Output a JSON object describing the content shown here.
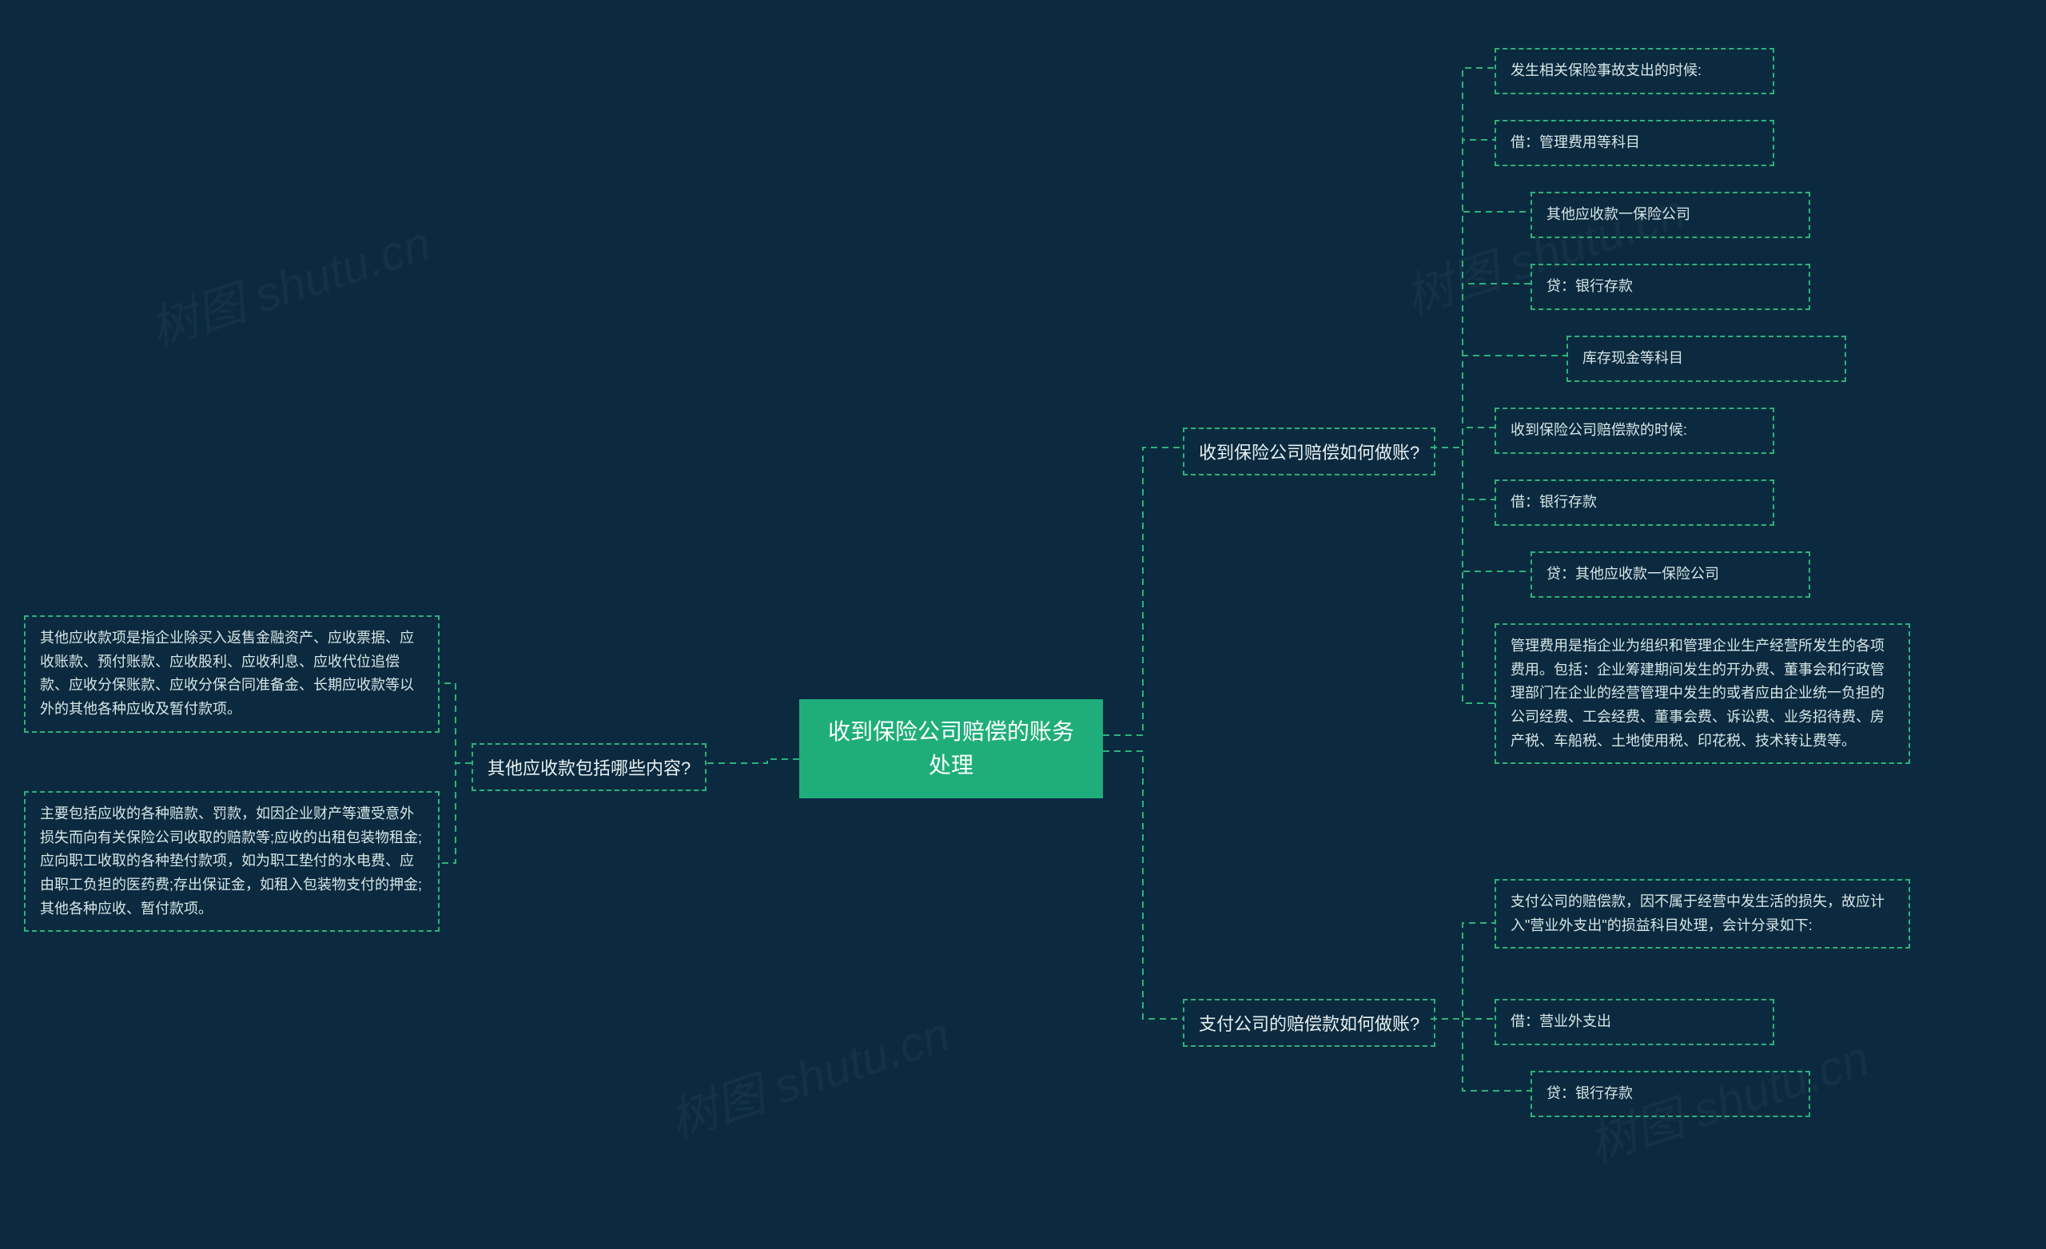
{
  "root": "收到保险公司赔偿的账务处理",
  "watermark": "树图 shutu.cn",
  "left": {
    "branch": "其他应收款包括哪些内容?",
    "leaves": [
      "其他应收款项是指企业除买入返售金融资产、应收票据、应收账款、预付账款、应收股利、应收利息、应收代位追偿款、应收分保账款、应收分保合同准备金、长期应收款等以外的其他各种应收及暂付款项。",
      "主要包括应收的各种赔款、罚款，如因企业财产等遭受意外损失而向有关保险公司收取的赔款等;应收的出租包装物租金;应向职工收取的各种垫付款项，如为职工垫付的水电费、应由职工负担的医药费;存出保证金，如租入包装物支付的押金;其他各种应收、暂付款项。"
    ]
  },
  "right1": {
    "branch": "收到保险公司赔偿如何做账?",
    "leaves": [
      "发生相关保险事故支出的时候:",
      "借：管理费用等科目",
      "其他应收款一保险公司",
      "贷：银行存款",
      "库存现金等科目",
      "收到保险公司赔偿款的时候:",
      "借：银行存款",
      "贷：其他应收款一保险公司",
      "管理费用是指企业为组织和管理企业生产经营所发生的各项费用。包括：企业筹建期间发生的开办费、董事会和行政管理部门在企业的经营管理中发生的或者应由企业统一负担的公司经费、工会经费、董事会费、诉讼费、业务招待费、房产税、车船税、土地使用税、印花税、技术转让费等。"
    ]
  },
  "right2": {
    "branch": "支付公司的赔偿款如何做账?",
    "leaves": [
      "支付公司的赔偿款，因不属于经营中发生活的损失，故应计入\"营业外支出\"的损益科目处理，会计分录如下:",
      "借：营业外支出",
      "贷：银行存款"
    ]
  }
}
